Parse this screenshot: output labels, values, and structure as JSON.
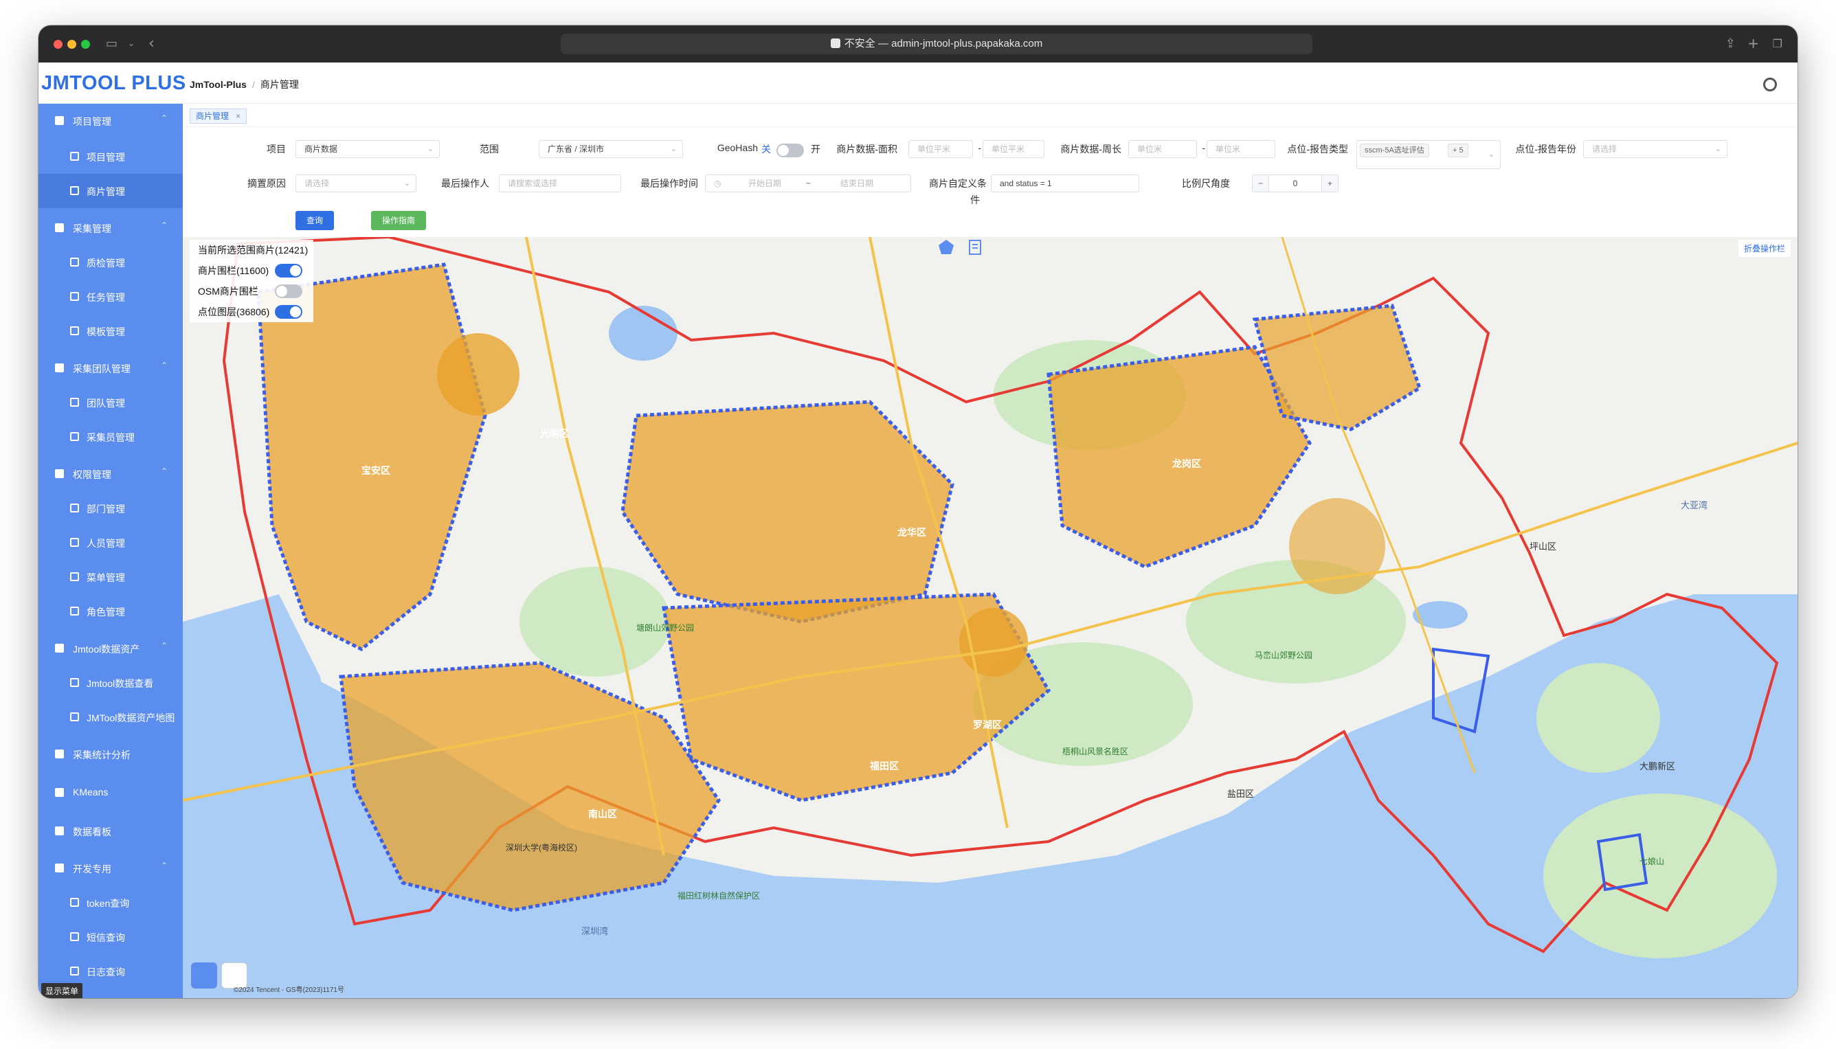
{
  "browser": {
    "url_text": "不安全 — admin-jmtool-plus.papakaka.com"
  },
  "header": {
    "logo": "JMTOOL PLUS",
    "breadcrumb_root": "JmTool-Plus",
    "breadcrumb_current": "商片管理"
  },
  "sidebar": {
    "groups": [
      {
        "label": "项目管理"
      },
      {
        "label": "采集管理"
      },
      {
        "label": "采集团队管理"
      },
      {
        "label": "权限管理"
      },
      {
        "label": "Jmtool数据资产"
      },
      {
        "label": "采集统计分析"
      },
      {
        "label": "KMeans"
      },
      {
        "label": "数据看板"
      },
      {
        "label": "开发专用"
      }
    ],
    "items": [
      {
        "label": "项目管理"
      },
      {
        "label": "商片管理"
      },
      {
        "label": "质检管理"
      },
      {
        "label": "任务管理"
      },
      {
        "label": "模板管理"
      },
      {
        "label": "团队管理"
      },
      {
        "label": "采集员管理"
      },
      {
        "label": "部门管理"
      },
      {
        "label": "人员管理"
      },
      {
        "label": "菜单管理"
      },
      {
        "label": "角色管理"
      },
      {
        "label": "Jmtool数据查看"
      },
      {
        "label": "JMTool数据资产地图"
      },
      {
        "label": "token查询"
      },
      {
        "label": "短信查询"
      },
      {
        "label": "日志查询"
      }
    ],
    "show_menu": "显示菜单",
    "accent_color": "#5b8def"
  },
  "tabs": {
    "active": "商片管理",
    "close": "×"
  },
  "filters": {
    "project_label": "项目",
    "project_value": "商片数据",
    "range_label": "范围",
    "range_value": "广东省 / 深圳市",
    "geohash_label": "GeoHash",
    "geohash_off": "关",
    "geohash_on": "开",
    "area_label": "商片数据-面积",
    "area_min_ph": "单位平米",
    "area_max_ph": "单位平米",
    "perimeter_label": "商片数据-周长",
    "perimeter_min_ph": "单位米",
    "perimeter_max_ph": "单位米",
    "report_type_label": "点位-报告类型",
    "report_type_tag": "sscm-5A选址评估",
    "report_type_more": "+ 5",
    "report_year_label": "点位-报告年份",
    "report_year_ph": "请选择",
    "close_reason_label": "摘置原因",
    "close_reason_ph": "请选择",
    "last_operator_label": "最后操作人",
    "last_operator_ph": "请搜索或选择",
    "last_time_label": "最后操作时间",
    "start_date_ph": "开始日期",
    "date_sep": "~",
    "end_date_ph": "结束日期",
    "custom_cond_label": "商片自定义条",
    "custom_cond_label2": "件",
    "custom_cond_value": "and status = 1",
    "scale_label": "比例尺角度",
    "scale_minus": "−",
    "scale_value": "0",
    "scale_plus": "+",
    "query_button": "查询",
    "guide_button": "操作指南",
    "dash": "-"
  },
  "map": {
    "summary": "当前所选范围商片(12421)",
    "layers": [
      {
        "label": "商片围栏(11600)",
        "on": true
      },
      {
        "label": "OSM商片围栏",
        "on": false
      },
      {
        "label": "点位图层(36806)",
        "on": true
      }
    ],
    "fold_button": "折叠操作栏",
    "copyright": "©2024 Tencent - GS粤(2023)1171号",
    "colors": {
      "fence": "#3b5ee8",
      "points": "#e8a22c",
      "boundary": "#e63a35",
      "green": "#cfe9c4",
      "water": "#9fc6f2"
    },
    "place_labels": [
      "光明区",
      "龙华区",
      "龙岗区",
      "南山区",
      "福田区",
      "罗湖区",
      "宝安区",
      "坪山区",
      "盐田区",
      "大鹏新区",
      "深圳湾",
      "大亚湾",
      "塘朗山郊野公园",
      "梧桐山风景名胜区",
      "马峦山郊野公园",
      "七娘山",
      "深圳大学(粤海校区)",
      "福田红树林自然保护区"
    ]
  }
}
